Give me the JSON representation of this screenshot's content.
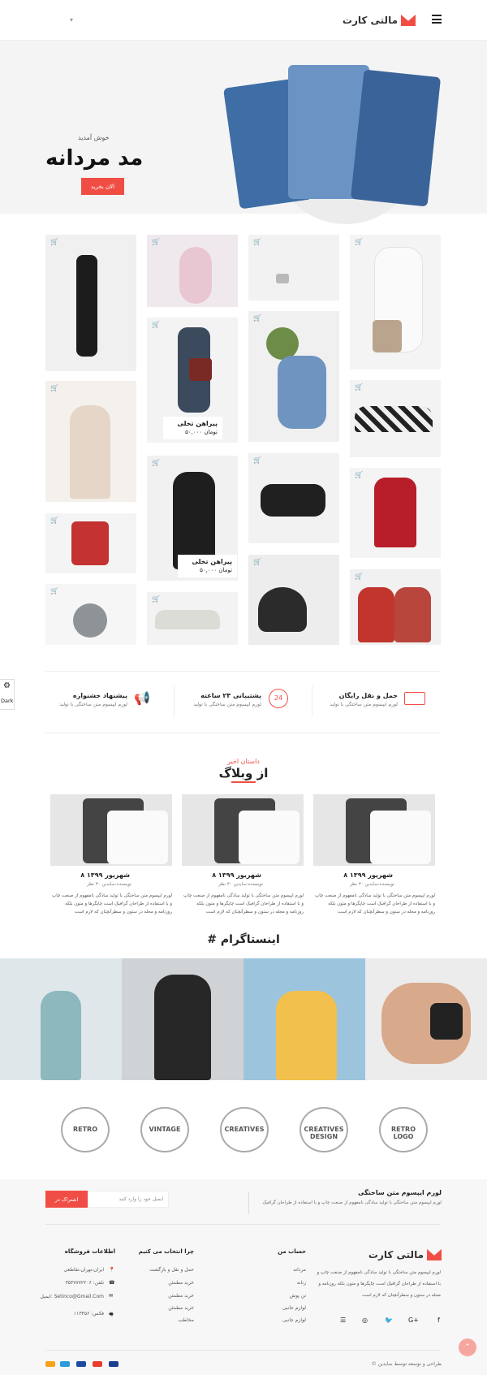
{
  "header": {
    "logo": "مالتی کارت"
  },
  "hero": {
    "welcome": "خوش آمدید",
    "title": "مد مردانه",
    "button": "الان بخرید"
  },
  "products": [
    {
      "name": "پیراهن تخلی",
      "price": "۵۰,۰۰۰ تومان"
    },
    {
      "name": "پیراهن تخلی",
      "price": "۵۰,۰۰۰ تومان"
    }
  ],
  "features": [
    {
      "title": "حمل و نقل رایگان",
      "sub": "لورم ایپسوم متن ساختگی با تولید"
    },
    {
      "title": "پشتیبانی ۲۴ ساعته",
      "sub": "لورم ایپسوم متن ساختگی با تولید"
    },
    {
      "title": "پیشنهاد جشنواره",
      "sub": "لورم ایپسوم متن ساختگی با تولید"
    }
  ],
  "side": {
    "dark": "Dark"
  },
  "blog": {
    "subtitle": "داستان اخیر",
    "title": "از وبلاگ",
    "posts": [
      {
        "date": "۸ شهریور ۱۳۹۹",
        "meta": "نویسنده:سایدین ۳۰ نظر",
        "text": "لورم ایپسوم متن ساختگی با تولید سادگی نامفهوم از صنعت چاپ و با استفاده از طراحان گرافیک است چاپگرها و متون بلکه روزنامه و مجله در ستون و سطرآنچنان که لازم است"
      },
      {
        "date": "۸ شهریور ۱۳۹۹",
        "meta": "نویسنده:سایدین ۳۰ نظر",
        "text": "لورم ایپسوم متن ساختگی با تولید سادگی نامفهوم از صنعت چاپ و با استفاده از طراحان گرافیک است چاپگرها و متون بلکه روزنامه و مجله در ستون و سطرآنچنان که لازم است"
      },
      {
        "date": "۸ شهریور ۱۳۹۹",
        "meta": "نویسنده:سایدین ۳۰ نظر",
        "text": "لورم ایپسوم متن ساختگی با تولید سادگی نامفهوم از صنعت چاپ و با استفاده از طراحان گرافیک است چاپگرها و متون بلکه روزنامه و مجله در ستون و سطرآنچنان که لازم است"
      }
    ]
  },
  "instagram": {
    "title": "# اینستاگرام"
  },
  "brands": [
    "RETRO LOGO",
    "CREATIVES DESIGN",
    "CREATIVES",
    "VINTAGE",
    "RETRO"
  ],
  "newsletter": {
    "title": "لورم ایپسوم متن ساختگی",
    "text": "لورم ایپسوم متن ساختگی با تولید سادگی نامفهوم از صنعت چاپ و با استفاده از طراحان گرافیک",
    "placeholder": "ایمیل خود را وارد کنید",
    "button": "اشتراک در"
  },
  "footer": {
    "logo": "مالتی کارت",
    "about": "لورم ایپسوم متن ساختگی با تولید سادگی نامفهوم از صنعت چاپ و با استفاده از طراحان گرافیک است چاپگرها و متون بلکه روزنامه و مجله در ستون و سطرآنچنان که لازم است",
    "account_title": "حساب من",
    "account_links": [
      "مردانه",
      "زنانه",
      "تن پوش",
      "لوازم جانبی",
      "لوازم جانبی"
    ],
    "why_title": "چرا انتخاب می کنیم",
    "why_links": [
      "حمل و نقل و بازگشت",
      "خرید مطمئن",
      "خرید مطمئن",
      "خرید مطمئن",
      "مخاطب"
    ],
    "info_title": "اطلاعات فروشگاه",
    "info_links": [
      "ایران،تهران،تقاطعی",
      "تلفن: ۳۵۳۷۷۷۲۲۰۶",
      "ایمیل: Setinco@Gmail.Com",
      "فکس: ۱۱۳۴۵۶"
    ],
    "copyright": "© طراحی و توسعه توسط سایدین"
  }
}
